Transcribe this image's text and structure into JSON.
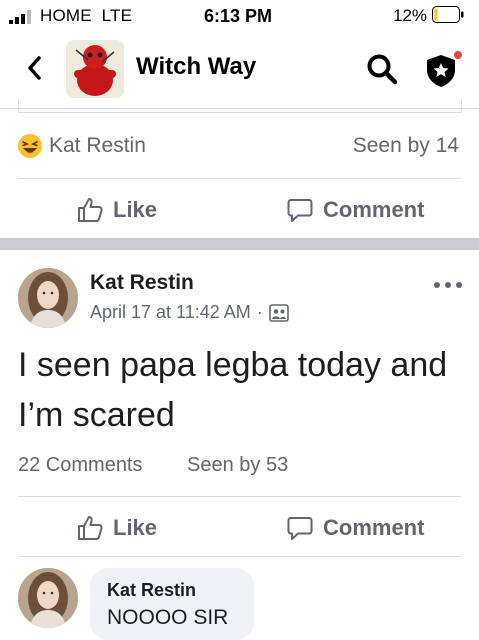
{
  "status_bar": {
    "carrier": "HOME  LTE",
    "time": "6:13 PM",
    "battery_percent": "12%",
    "battery_level": 0.12
  },
  "nav": {
    "title": "Witch Way"
  },
  "previous_post": {
    "author": "Kat Restin",
    "seen": "Seen by 14",
    "like_label": "Like",
    "comment_label": "Comment"
  },
  "post": {
    "author": "Kat Restin",
    "timestamp": "April 17 at 11:42 AM",
    "separator": "·",
    "text": "I seen papa legba today and I’m scared",
    "comments_count": "22 Comments",
    "seen": "Seen by 53",
    "like_label": "Like",
    "comment_label": "Comment"
  },
  "comment": {
    "author": "Kat Restin",
    "text": "NOOOO SIR"
  },
  "colors": {
    "accent": "#000000",
    "secondary_text": "#606770",
    "notification_dot": "#e4473b",
    "battery_fill": "#f5c518"
  }
}
